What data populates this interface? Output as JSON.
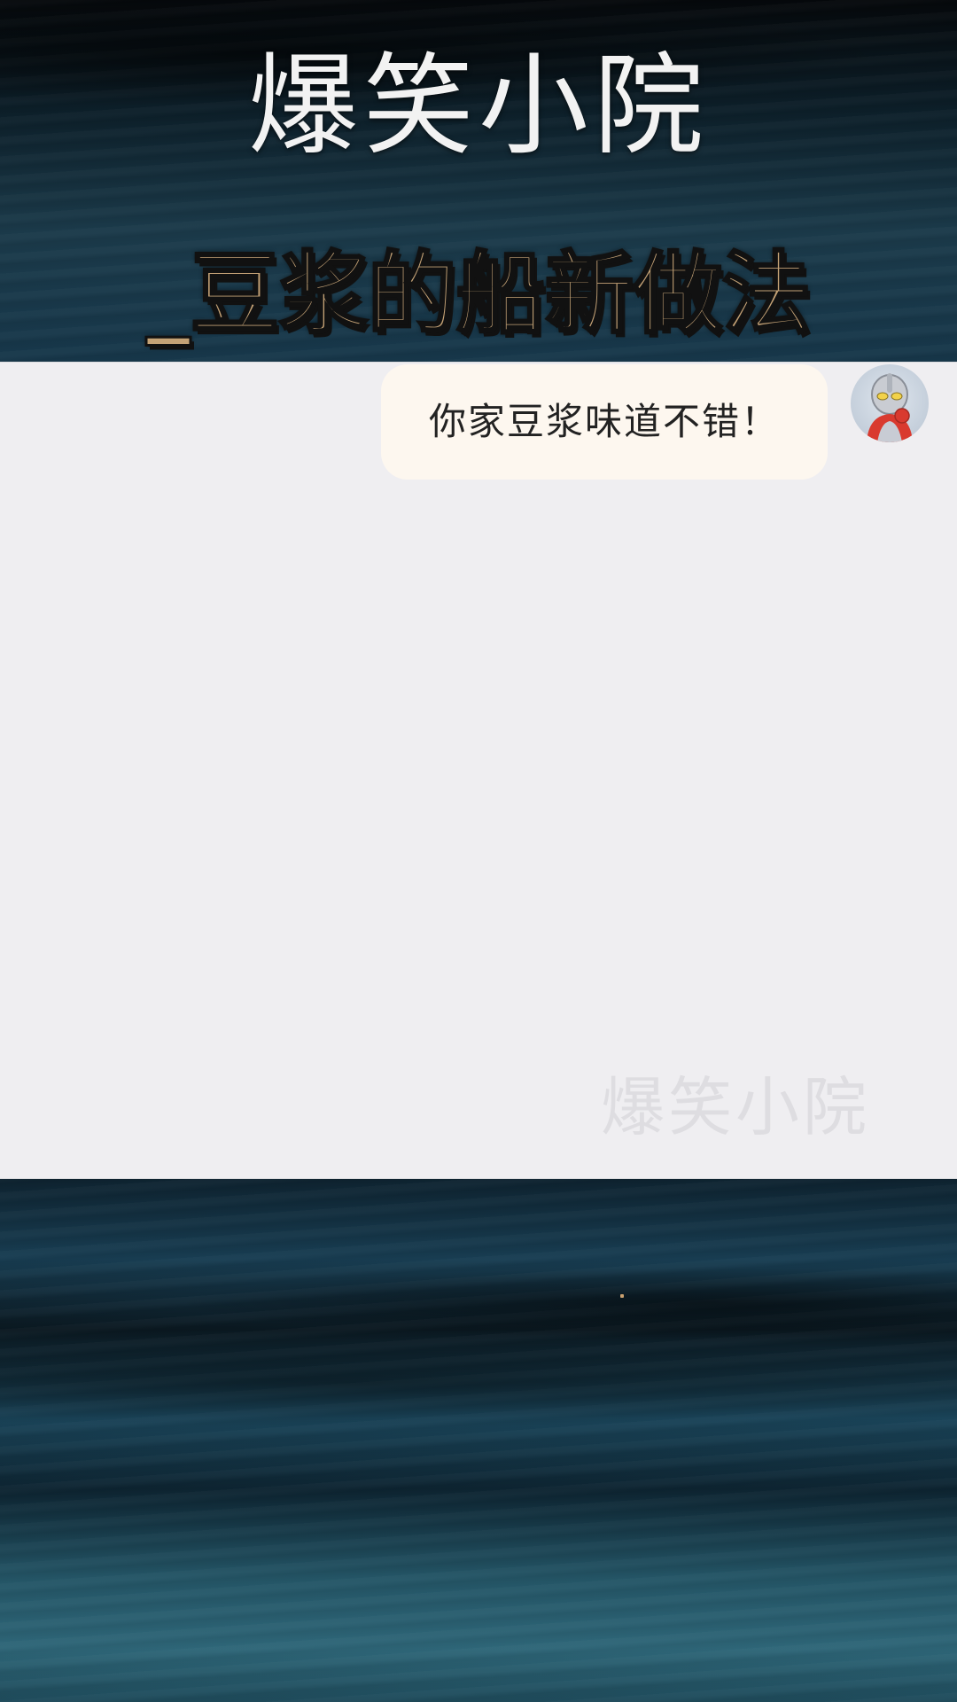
{
  "header": {
    "show_title": "爆笑小院",
    "episode_title": "_豆浆的船新做法"
  },
  "chat": {
    "messages": [
      {
        "sender": "right",
        "text": "你家豆浆味道不错！",
        "avatar_icon": "ultraman-avatar-icon"
      }
    ],
    "watermark": "爆笑小院"
  },
  "colors": {
    "episode_title": "#c4a276",
    "chat_background": "#efeef1",
    "bubble_background": "#fdf7ef"
  }
}
